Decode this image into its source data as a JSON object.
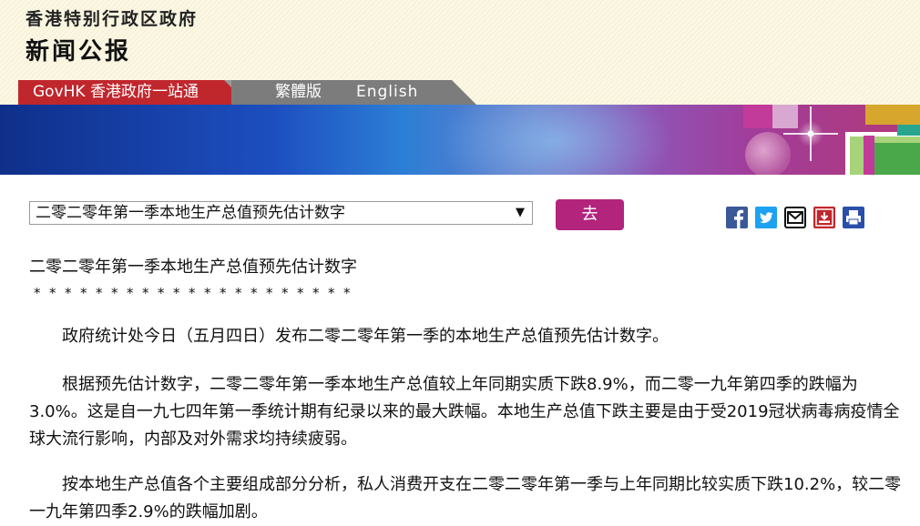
{
  "header": {
    "org_name": "香港特别行政区政府",
    "section_title": "新闻公报"
  },
  "nav": {
    "govhk": "GovHK 香港政府一站通",
    "traditional": "繁體版",
    "english": "English"
  },
  "toolbar": {
    "select_value": "二零二零年第一季本地生产总值预先估计数字",
    "go_label": "去",
    "share_icons": [
      "facebook-icon",
      "twitter-icon",
      "email-icon",
      "download-icon",
      "print-icon"
    ]
  },
  "colors": {
    "govhk_red": "#c0272d",
    "go_button": "#b3247c",
    "facebook": "#3b5998",
    "twitter": "#1da1f2",
    "download": "#c0272d",
    "print": "#2a4fa8"
  },
  "article": {
    "title": "二零二零年第一季本地生产总值预先估计数字",
    "stars": "*********************",
    "paragraphs": [
      "政府统计处今日（五月四日）发布二零二零年第一季的本地生产总值预先估计数字。",
      "根据预先估计数字，二零二零年第一季本地生产总值较上年同期实质下跌8.9%，而二零一九年第四季的跌幅为3.0%。这是自一九七四年第一季统计期有纪录以来的最大跌幅。本地生产总值下跌主要是由于受2019冠状病毒病疫情全球大流行影响，内部及对外需求均持续疲弱。",
      "按本地生产总值各个主要组成部分分析，私人消费开支在二零二零年第一季与上年同期比较实质下跌10.2%，较二零一九年第四季2.9%的跌幅加剧。"
    ]
  }
}
